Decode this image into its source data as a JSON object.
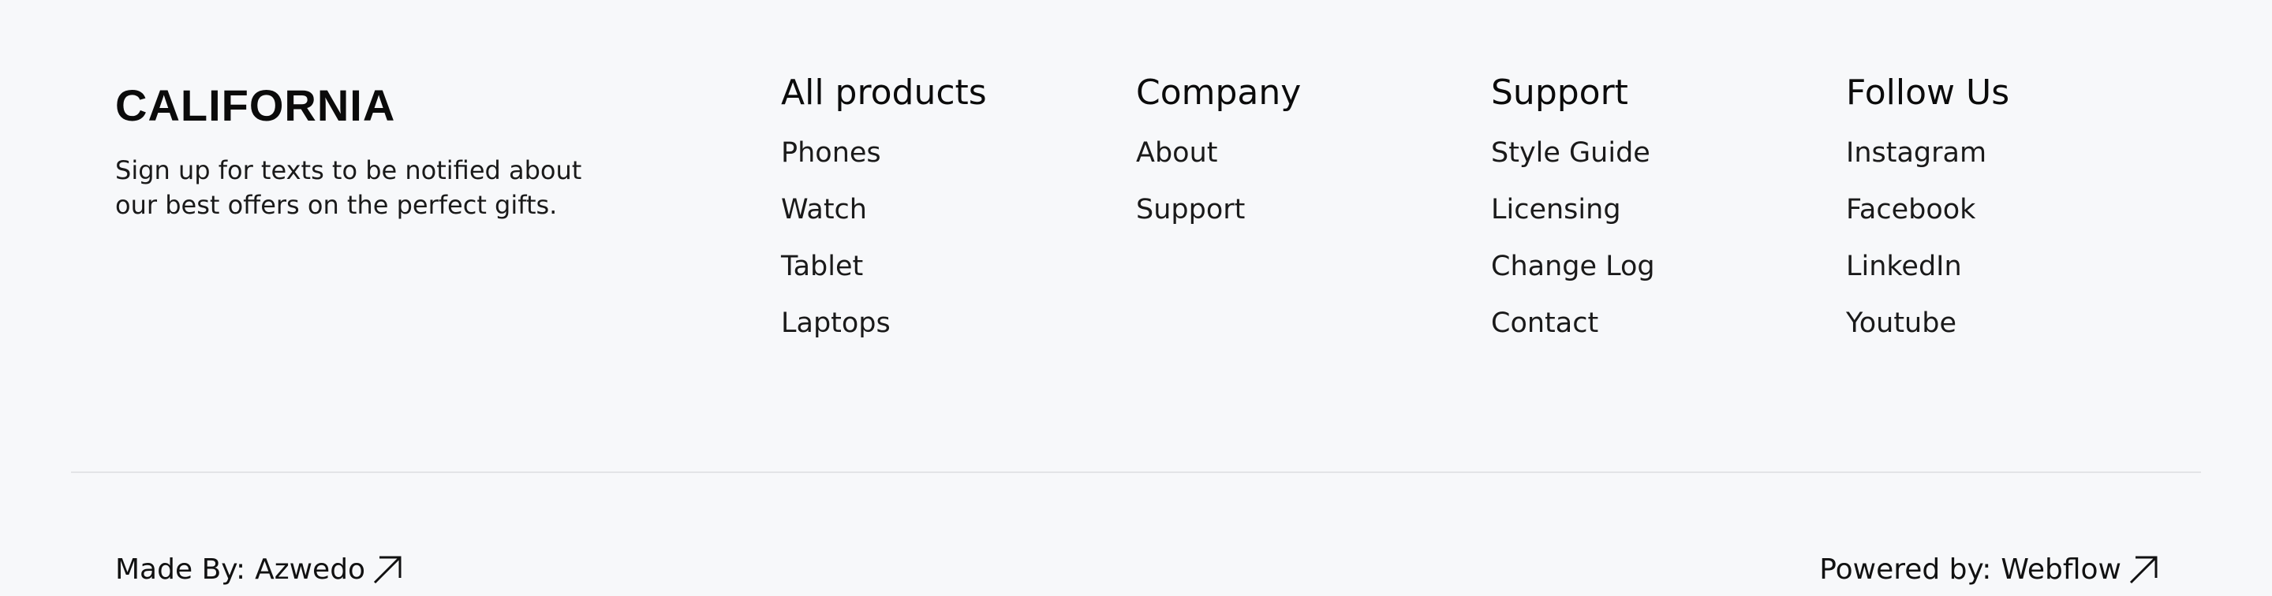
{
  "brand": {
    "logo": "CALIFORNIA",
    "tagline": "Sign up for texts to be notified about our best offers on the perfect gifts."
  },
  "columns": [
    {
      "heading": "All products",
      "items": [
        "Phones",
        "Watch",
        "Tablet",
        "Laptops"
      ]
    },
    {
      "heading": "Company",
      "items": [
        "About",
        "Support"
      ]
    },
    {
      "heading": "Support",
      "items": [
        "Style Guide",
        "Licensing",
        "Change Log",
        "Contact"
      ]
    },
    {
      "heading": "Follow Us",
      "items": [
        "Instagram",
        "Facebook",
        "LinkedIn",
        "Youtube"
      ]
    }
  ],
  "credits": {
    "made_by_label": "Made By:",
    "made_by_link": "Azwedo",
    "powered_by_label": "Powered by:",
    "powered_by_link": "Webflow"
  },
  "icons": {
    "external_link": "arrow-up-right-icon"
  }
}
